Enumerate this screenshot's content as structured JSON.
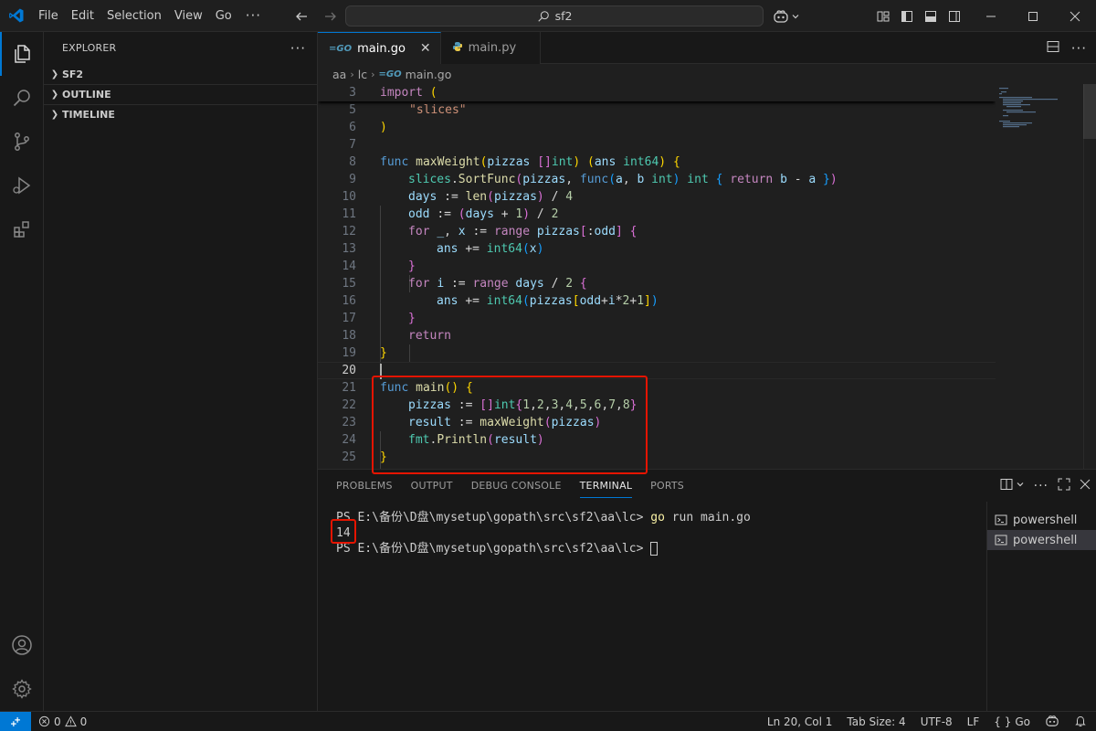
{
  "menu": [
    "File",
    "Edit",
    "Selection",
    "View",
    "Go"
  ],
  "search": {
    "text": "sf2"
  },
  "explorer": {
    "title": "EXPLORER",
    "sections": [
      "SF2",
      "OUTLINE",
      "TIMELINE"
    ]
  },
  "tabs": [
    {
      "label": "main.go",
      "active": true
    },
    {
      "label": "main.py",
      "active": false
    }
  ],
  "breadcrumb": [
    "aa",
    "lc",
    "main.go"
  ],
  "code": {
    "lines": [
      {
        "n": "3",
        "text": "import ("
      },
      {
        "n": "5",
        "text": "\"slices\""
      },
      {
        "n": "6",
        "text": ")"
      },
      {
        "n": "7",
        "text": ""
      },
      {
        "n": "8",
        "text": "func maxWeight(pizzas []int) (ans int64) {"
      },
      {
        "n": "9",
        "text": "slices.SortFunc(pizzas, func(a, b int) int { return b - a })"
      },
      {
        "n": "10",
        "text": "days := len(pizzas) / 4"
      },
      {
        "n": "11",
        "text": "odd := (days + 1) / 2"
      },
      {
        "n": "12",
        "text": "for _, x := range pizzas[:odd] {"
      },
      {
        "n": "13",
        "text": "ans += int64(x)"
      },
      {
        "n": "14",
        "text": "}"
      },
      {
        "n": "15",
        "text": "for i := range days / 2 {"
      },
      {
        "n": "16",
        "text": "ans += int64(pizzas[odd+i*2+1])"
      },
      {
        "n": "17",
        "text": "}"
      },
      {
        "n": "18",
        "text": "return"
      },
      {
        "n": "19",
        "text": "}"
      },
      {
        "n": "20",
        "text": ""
      },
      {
        "n": "21",
        "text": "func main() {"
      },
      {
        "n": "22",
        "text": "pizzas := []int{1,2,3,4,5,6,7,8}"
      },
      {
        "n": "23",
        "text": "result := maxWeight(pizzas)"
      },
      {
        "n": "24",
        "text": "fmt.Println(result)"
      },
      {
        "n": "25",
        "text": "}"
      }
    ]
  },
  "panel": {
    "tabs": [
      "PROBLEMS",
      "OUTPUT",
      "DEBUG CONSOLE",
      "TERMINAL",
      "PORTS"
    ],
    "active_tab": "TERMINAL",
    "terminal_lines": [
      {
        "prompt": "PS E:\\备份\\D盘\\mysetup\\gopath\\src\\sf2\\aa\\lc> ",
        "cmd_kw": "go",
        "cmd_rest": " run main.go"
      },
      {
        "output": "14"
      },
      {
        "prompt": "PS E:\\备份\\D盘\\mysetup\\gopath\\src\\sf2\\aa\\lc> "
      }
    ],
    "terminals": [
      {
        "label": "powershell",
        "selected": false
      },
      {
        "label": "powershell",
        "selected": true
      }
    ]
  },
  "status": {
    "errors": "0",
    "warnings": "0",
    "position": "Ln 20, Col 1",
    "tab_size": "Tab Size: 4",
    "encoding": "UTF-8",
    "eol": "LF",
    "language": "Go"
  },
  "colors": {
    "accent": "#0078d4",
    "highlight": "#e51400"
  }
}
